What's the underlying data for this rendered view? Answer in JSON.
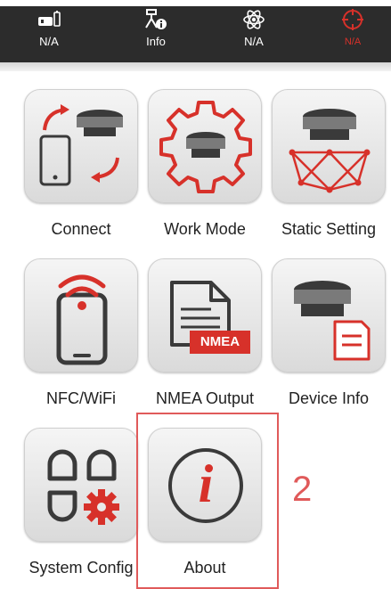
{
  "topbar": {
    "items": [
      {
        "label": "N/A",
        "icon": "battery-icon"
      },
      {
        "label": "Info",
        "icon": "antenna-info-icon"
      },
      {
        "label": "N/A",
        "icon": "satellite-icon"
      },
      {
        "label": "N/A",
        "icon": "target-icon",
        "active": true
      }
    ]
  },
  "menu": {
    "items": [
      {
        "label": "Connect",
        "icon": "connect-icon"
      },
      {
        "label": "Work Mode",
        "icon": "work-mode-icon"
      },
      {
        "label": "Static Setting",
        "icon": "static-setting-icon"
      },
      {
        "label": "NFC/WiFi",
        "icon": "nfc-wifi-icon"
      },
      {
        "label": "NMEA Output",
        "icon": "nmea-output-icon",
        "badge": "NMEA"
      },
      {
        "label": "Device Info",
        "icon": "device-info-icon"
      },
      {
        "label": "System Config",
        "icon": "system-config-icon"
      },
      {
        "label": "About",
        "icon": "about-icon",
        "glyph": "i"
      }
    ]
  },
  "annotation": {
    "step": "2"
  },
  "colors": {
    "accent": "#d7312a",
    "topbar": "#2c2c2c",
    "annotation": "#e05a5a"
  }
}
